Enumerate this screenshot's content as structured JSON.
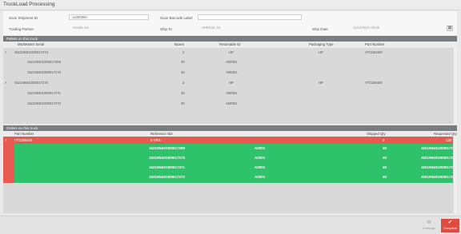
{
  "window": {
    "title": "TruckLoad Processing"
  },
  "form": {
    "scan_shipment_label": "Scan Shipment ID",
    "scan_shipment_value": "11000860",
    "scan_barcode_label": "Scan Barcode Label",
    "scan_barcode_value": "",
    "trading_partner_label": "Trading Partner",
    "trading_partner_value": "Honda US",
    "ship_to_label": "Ship To",
    "ship_to_value": "SHR442, 01",
    "ship_date_label": "Ship Date",
    "ship_date_value": "11/12/2021 00:00"
  },
  "pallets": {
    "section_title": "Pallets on this truck",
    "columns": {
      "serial": "Mix/Master Serial",
      "boxes": "Boxes",
      "returnable": "Returnable ID",
      "packaging": "Packaging Type",
      "part": "Part Number"
    },
    "rows": [
      {
        "toggle": "+",
        "serial": "452106401000017274",
        "boxes": "2",
        "returnable": "HP",
        "packaging": "HP",
        "part": "VT2186400"
      },
      {
        "toggle": "",
        "serial": "152106401000017269",
        "boxes": "30",
        "returnable": "A00001",
        "packaging": "",
        "part": ""
      },
      {
        "toggle": "",
        "serial": "152106401000017270",
        "boxes": "30",
        "returnable": "A00001",
        "packaging": "",
        "part": ""
      },
      {
        "toggle": "+",
        "serial": "452106401000017275",
        "boxes": "2",
        "returnable": "HP",
        "packaging": "HP",
        "part": "VT2186400"
      },
      {
        "toggle": "",
        "serial": "152106401000017271",
        "boxes": "30",
        "returnable": "A00001",
        "packaging": "",
        "part": ""
      },
      {
        "toggle": "",
        "serial": "152106401000017272",
        "boxes": "30",
        "returnable": "A00001",
        "packaging": "",
        "part": ""
      }
    ]
  },
  "orders": {
    "section_title": "Orders on this truck",
    "columns": {
      "part": "Part Number",
      "ref": "Reference Nbr",
      "shipped": "Shipped Qty",
      "requested": "Requested Qty"
    },
    "header_row": {
      "toggle": "+",
      "part": "VT2186400",
      "ref": "5-VRS",
      "shipped": "0",
      "requested": "120"
    },
    "rows": [
      {
        "serial": "152106401000017269",
        "returnable": "A0001",
        "qty": "30",
        "master": "452106401000017274"
      },
      {
        "serial": "152106401000017270",
        "returnable": "A0001",
        "qty": "30",
        "master": "452106401000017274"
      },
      {
        "serial": "152106401000017271",
        "returnable": "A0001",
        "qty": "30",
        "master": "452106401000017275"
      },
      {
        "serial": "152106401000017272",
        "returnable": "A0001",
        "qty": "30",
        "master": "452106401000017275"
      }
    ],
    "colors": {
      "red": "#e85a4f",
      "green": "#2ec26a"
    }
  },
  "footer": {
    "unassign_label": "Unassign",
    "complete_label": "Complete",
    "unassign_icon": "unassign-icon",
    "complete_icon": "check-icon"
  }
}
